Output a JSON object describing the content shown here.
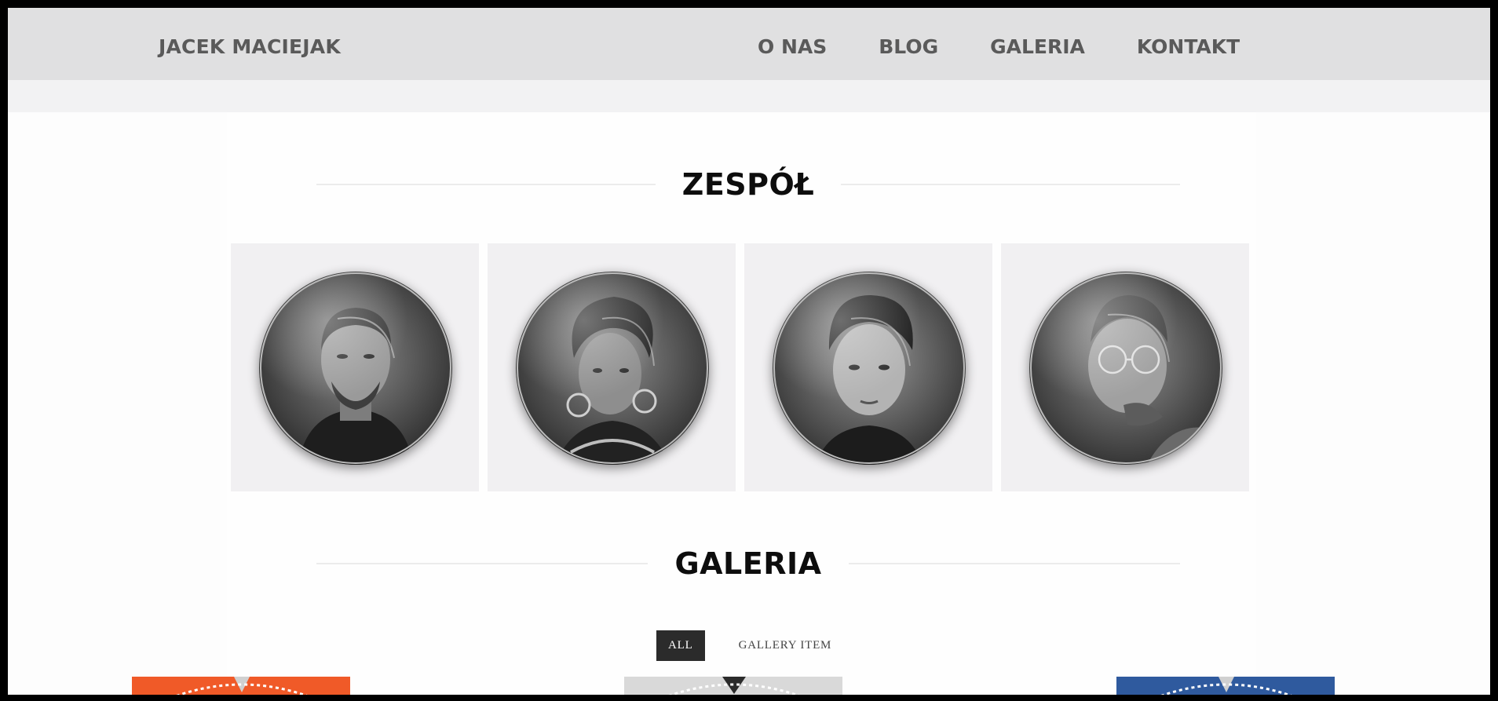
{
  "header": {
    "brand": "JACEK MACIEJAK",
    "nav": [
      "O NAS",
      "BLOG",
      "GALERIA",
      "KONTAKT"
    ]
  },
  "team": {
    "title": "ZESPÓŁ",
    "members": [
      {
        "photo": "man-beard-portrait"
      },
      {
        "photo": "woman-hoop-earrings-portrait"
      },
      {
        "photo": "young-man-portrait"
      },
      {
        "photo": "man-glasses-portrait"
      }
    ]
  },
  "gallery": {
    "title": "GALERIA",
    "filters": [
      {
        "label": "ALL",
        "active": true
      },
      {
        "label": "GALLERY ITEM",
        "active": false
      }
    ],
    "thumbnails": [
      {
        "color": "#f05a28"
      },
      {
        "color": "#d9d9d9"
      },
      {
        "color": "#2f5a9e"
      }
    ]
  },
  "colors": {
    "navbar_bg": "#e0e0e1",
    "nav_text": "#5a5a5a",
    "card_bg": "#f1f0f2",
    "active_filter_bg": "#2b2b2b"
  }
}
